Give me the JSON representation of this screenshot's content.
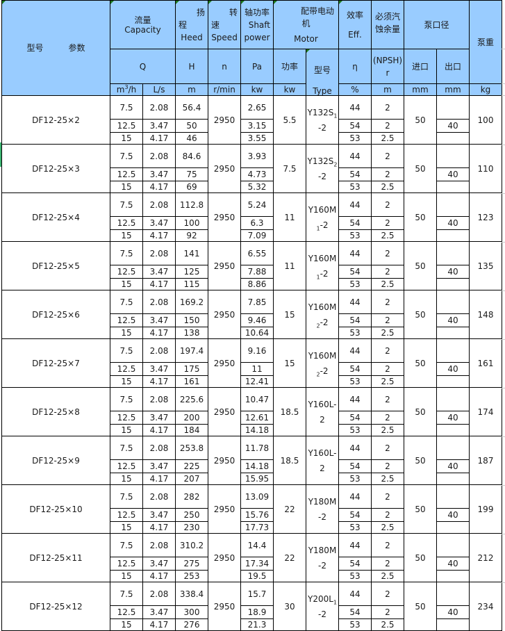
{
  "header": {
    "model_label": "型号",
    "params_label": "参数",
    "capacity_cn": "流量",
    "capacity_en": "Capacity",
    "head_cn_1": "扬",
    "head_cn_2": "程",
    "head_en": "Heed",
    "speed_cn_1": "转",
    "speed_cn_2": "速",
    "speed_en": "Speed",
    "shaft_cn": "轴功率",
    "shaft_en_1": "Shaft",
    "shaft_en_2": "power",
    "motor_cn_1": "配带电动",
    "motor_cn_2": "机",
    "motor_en": "Motor",
    "eff_cn": "效率",
    "eff_en": "Eff.",
    "npsh_cn_1": "必须汽",
    "npsh_cn_2": "蚀余量",
    "port_cn": "泵口径",
    "weight_cn": "泵重",
    "sym_q": "Q",
    "sym_h": "H",
    "sym_n": "n",
    "sym_pa": "Pa",
    "sym_motor_power": "功率",
    "sym_motor_type_cn": "型号",
    "sym_eff": "η",
    "sym_npsh_1": "(NPSH)",
    "sym_npsh_2": "r",
    "sym_inlet": "进口",
    "sym_outlet": "出口",
    "unit_m3h_base": "m",
    "unit_m3h_sup": "3",
    "unit_m3h_tail": "/h",
    "unit_ls": "L/s",
    "unit_h": "m",
    "unit_n": "r/min",
    "unit_pa": "kw",
    "unit_motor_kw": "kw",
    "unit_motor_type": "Type",
    "unit_eff": "%",
    "unit_npsh": "m",
    "unit_inlet": "mm",
    "unit_outlet": "mm",
    "unit_weight": "kg"
  },
  "models": [
    {
      "name": "DF12-25×2",
      "speed": "2950",
      "motor_kw": "5.5",
      "motor_type_main": "Y132S",
      "motor_type_sub": "1",
      "motor_type_tail": "-2",
      "inlet": "50",
      "outlet": "40",
      "weight": "100",
      "rows": [
        {
          "q": "7.5",
          "ls": "2.08",
          "h": "56.4",
          "pa": "2.65",
          "eff": "44",
          "npsh": "2"
        },
        {
          "q": "12.5",
          "ls": "3.47",
          "h": "50",
          "pa": "3.15",
          "eff": "54",
          "npsh": "2"
        },
        {
          "q": "15",
          "ls": "4.17",
          "h": "46",
          "pa": "3.55",
          "eff": "53",
          "npsh": "2.5"
        }
      ]
    },
    {
      "name": "DF12-25×3",
      "speed": "2950",
      "motor_kw": "7.5",
      "motor_type_main": "Y132S",
      "motor_type_sub": "2",
      "motor_type_tail": "-2",
      "inlet": "50",
      "outlet": "40",
      "weight": "110",
      "rows": [
        {
          "q": "7.5",
          "ls": "2.08",
          "h": "84.6",
          "pa": "3.93",
          "eff": "44",
          "npsh": "2"
        },
        {
          "q": "12.5",
          "ls": "3.47",
          "h": "75",
          "pa": "4.73",
          "eff": "54",
          "npsh": "2"
        },
        {
          "q": "15",
          "ls": "4.17",
          "h": "69",
          "pa": "5.32",
          "eff": "53",
          "npsh": "2.5"
        }
      ]
    },
    {
      "name": "DF12-25×4",
      "speed": "2950",
      "motor_kw": "11",
      "motor_type_main": "Y160M",
      "motor_type_sub": "1",
      "motor_type_tail": "-2",
      "inlet": "50",
      "outlet": "40",
      "weight": "123",
      "rows": [
        {
          "q": "7.5",
          "ls": "2.08",
          "h": "112.8",
          "pa": "5.24",
          "eff": "44",
          "npsh": "2"
        },
        {
          "q": "12.5",
          "ls": "3.47",
          "h": "100",
          "pa": "6.3",
          "eff": "54",
          "npsh": "2"
        },
        {
          "q": "15",
          "ls": "4.17",
          "h": "92",
          "pa": "7.09",
          "eff": "53",
          "npsh": "2.5"
        }
      ]
    },
    {
      "name": "DF12-25×5",
      "speed": "2950",
      "motor_kw": "11",
      "motor_type_main": "Y160M",
      "motor_type_sub": "1",
      "motor_type_tail": "-2",
      "inlet": "50",
      "outlet": "40",
      "weight": "135",
      "rows": [
        {
          "q": "7.5",
          "ls": "2.08",
          "h": "141",
          "pa": "6.55",
          "eff": "44",
          "npsh": "2"
        },
        {
          "q": "12.5",
          "ls": "3.47",
          "h": "125",
          "pa": "7.88",
          "eff": "54",
          "npsh": "2"
        },
        {
          "q": "15",
          "ls": "4.17",
          "h": "115",
          "pa": "8.86",
          "eff": "53",
          "npsh": "2.5"
        }
      ]
    },
    {
      "name": "DF12-25×6",
      "speed": "2950",
      "motor_kw": "15",
      "motor_type_main": "Y160M",
      "motor_type_sub": "2",
      "motor_type_tail": "-2",
      "inlet": "50",
      "outlet": "40",
      "weight": "148",
      "rows": [
        {
          "q": "7.5",
          "ls": "2.08",
          "h": "169.2",
          "pa": "7.85",
          "eff": "44",
          "npsh": "2"
        },
        {
          "q": "12.5",
          "ls": "3.47",
          "h": "150",
          "pa": "9.46",
          "eff": "54",
          "npsh": "2"
        },
        {
          "q": "15",
          "ls": "4.17",
          "h": "138",
          "pa": "10.64",
          "eff": "53",
          "npsh": "2.5"
        }
      ]
    },
    {
      "name": "DF12-25×7",
      "speed": "2950",
      "motor_kw": "15",
      "motor_type_main": "Y160M",
      "motor_type_sub": "2",
      "motor_type_tail": "-2",
      "inlet": "50",
      "outlet": "40",
      "weight": "161",
      "rows": [
        {
          "q": "7.5",
          "ls": "2.08",
          "h": "197.4",
          "pa": "9.16",
          "eff": "44",
          "npsh": "2"
        },
        {
          "q": "12.5",
          "ls": "3.47",
          "h": "175",
          "pa": "11",
          "eff": "54",
          "npsh": "2"
        },
        {
          "q": "15",
          "ls": "4.17",
          "h": "161",
          "pa": "12.41",
          "eff": "53",
          "npsh": "2.5"
        }
      ]
    },
    {
      "name": "DF12-25×8",
      "speed": "2950",
      "motor_kw": "18.5",
      "motor_type_main": "Y160L-",
      "motor_type_sub": "",
      "motor_type_tail": "2",
      "inlet": "50",
      "outlet": "40",
      "weight": "174",
      "rows": [
        {
          "q": "7.5",
          "ls": "2.08",
          "h": "225.6",
          "pa": "10.47",
          "eff": "44",
          "npsh": "2"
        },
        {
          "q": "12.5",
          "ls": "3.47",
          "h": "200",
          "pa": "12.61",
          "eff": "54",
          "npsh": "2"
        },
        {
          "q": "15",
          "ls": "4.17",
          "h": "184",
          "pa": "14.18",
          "eff": "53",
          "npsh": "2.5"
        }
      ]
    },
    {
      "name": "DF12-25×9",
      "speed": "2950",
      "motor_kw": "18.5",
      "motor_type_main": "Y160L-",
      "motor_type_sub": "",
      "motor_type_tail": "2",
      "inlet": "50",
      "outlet": "40",
      "weight": "187",
      "rows": [
        {
          "q": "7.5",
          "ls": "2.08",
          "h": "253.8",
          "pa": "11.78",
          "eff": "44",
          "npsh": "2"
        },
        {
          "q": "12.5",
          "ls": "3.47",
          "h": "225",
          "pa": "14.18",
          "eff": "54",
          "npsh": "2"
        },
        {
          "q": "15",
          "ls": "4.17",
          "h": "207",
          "pa": "15.95",
          "eff": "53",
          "npsh": "2.5"
        }
      ]
    },
    {
      "name": "DF12-25×10",
      "speed": "2950",
      "motor_kw": "22",
      "motor_type_main": "Y180M",
      "motor_type_sub": "",
      "motor_type_tail": "-2",
      "inlet": "50",
      "outlet": "40",
      "weight": "199",
      "rows": [
        {
          "q": "7.5",
          "ls": "2.08",
          "h": "282",
          "pa": "13.09",
          "eff": "44",
          "npsh": "2"
        },
        {
          "q": "12.5",
          "ls": "3.47",
          "h": "250",
          "pa": "15.76",
          "eff": "54",
          "npsh": "2"
        },
        {
          "q": "15",
          "ls": "4.17",
          "h": "230",
          "pa": "17.73",
          "eff": "53",
          "npsh": "2.5"
        }
      ]
    },
    {
      "name": "DF12-25×11",
      "speed": "2950",
      "motor_kw": "22",
      "motor_type_main": "Y180M",
      "motor_type_sub": "",
      "motor_type_tail": "-2",
      "inlet": "50",
      "outlet": "40",
      "weight": "212",
      "rows": [
        {
          "q": "7.5",
          "ls": "2.08",
          "h": "310.2",
          "pa": "14.4",
          "eff": "44",
          "npsh": "2"
        },
        {
          "q": "12.5",
          "ls": "3.47",
          "h": "275",
          "pa": "17.34",
          "eff": "54",
          "npsh": "2"
        },
        {
          "q": "15",
          "ls": "4.17",
          "h": "253",
          "pa": "19.5",
          "eff": "53",
          "npsh": "2.5"
        }
      ]
    },
    {
      "name": "DF12-25×12",
      "speed": "2950",
      "motor_kw": "30",
      "motor_type_main": "Y200L",
      "motor_type_sub": "1",
      "motor_type_tail": "-2",
      "inlet": "50",
      "outlet": "40",
      "weight": "234",
      "rows": [
        {
          "q": "7.5",
          "ls": "2.08",
          "h": "338.4",
          "pa": "15.7",
          "eff": "44",
          "npsh": "2"
        },
        {
          "q": "12.5",
          "ls": "3.47",
          "h": "300",
          "pa": "18.9",
          "eff": "54",
          "npsh": "2"
        },
        {
          "q": "15",
          "ls": "4.17",
          "h": "276",
          "pa": "21.3",
          "eff": "53",
          "npsh": "2.5"
        }
      ]
    }
  ]
}
